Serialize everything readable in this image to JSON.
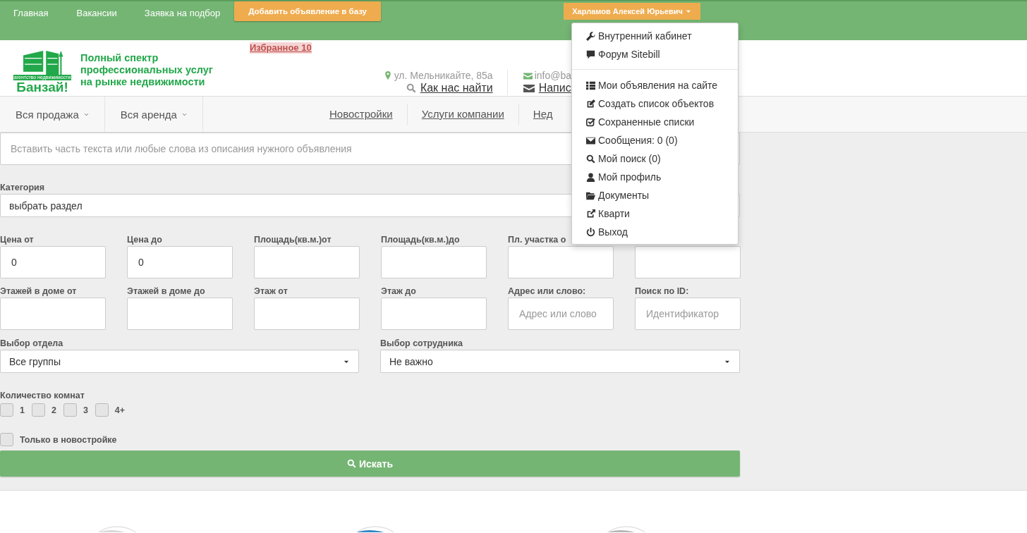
{
  "top_nav": {
    "links": [
      "Главная",
      "Вакансии",
      "Заявка на подбор"
    ],
    "add_button": "Добавить объявление в базу",
    "user_button": "Харламов Алексей Юрьевич"
  },
  "header": {
    "logo_name": "Банзай!",
    "logo_subtitle": "агентство недвижимости",
    "tagline_lines": [
      "Полный спектр",
      "профессиональных услуг",
      "на рынке недвижимости"
    ],
    "favorites": "Избранное 10",
    "address": "ул. Мельникайте, 85а",
    "find_link": "Как нас найти",
    "email": "info@ba",
    "write_link": "Напис"
  },
  "nav": {
    "dropdowns": [
      "Вся продажа",
      "Вся аренда"
    ],
    "links": [
      "Новостройки",
      "Услуги компании",
      "Нед"
    ]
  },
  "search": {
    "placeholder": "Вставить часть текста или любые слова из описания нужного объявления"
  },
  "form": {
    "category": {
      "label": "Категория",
      "value": "выбрать раздел"
    },
    "fields": [
      {
        "kind": "labeled",
        "label": "Цена от",
        "value": "0"
      },
      {
        "kind": "labeled",
        "label": "Цена до",
        "value": "0"
      },
      {
        "kind": "labeled",
        "label": "Площадь(кв.м.)от"
      },
      {
        "kind": "labeled",
        "label": "Площадь(кв.м.)до"
      },
      {
        "kind": "labeled",
        "label": "Пл. участка о"
      },
      {
        "kind": "bare"
      },
      {
        "kind": "labeled",
        "label": "Этажей в доме от"
      },
      {
        "kind": "labeled",
        "label": "Этажей в доме до"
      },
      {
        "kind": "labeled",
        "label": "Этаж от"
      },
      {
        "kind": "labeled",
        "label": "Этаж до"
      },
      {
        "kind": "labeled",
        "label": "Адрес или слово:",
        "placeholder": "Адрес или слово"
      },
      {
        "kind": "labeled",
        "label": "Поиск по ID:",
        "placeholder": "Идентификатор"
      }
    ],
    "selects": [
      {
        "label": "Выбор отдела",
        "value": "Все группы"
      },
      {
        "label": "Выбор сотрудника",
        "value": "Не важно"
      }
    ],
    "rooms": {
      "label": "Количество комнат",
      "options": [
        {
          "label": "1",
          "checked": false
        },
        {
          "label": "2",
          "checked": false
        },
        {
          "label": "3",
          "checked": false
        },
        {
          "label": "4+",
          "checked": false
        }
      ]
    },
    "new_only": {
      "label": "Только в новостройке",
      "checked": false
    },
    "submit": "Искать"
  },
  "user_menu": {
    "sections": [
      [
        "Внутренний кабинет",
        "Форум Sitebill"
      ],
      [
        "Мои объявления на сайте",
        "Создать список объектов",
        "Сохраненные списки",
        "Сообщения: 0 (0)",
        "Мой поиск (0)",
        "Мой профиль",
        "Документы",
        "Кварти",
        "Выход"
      ]
    ]
  }
}
